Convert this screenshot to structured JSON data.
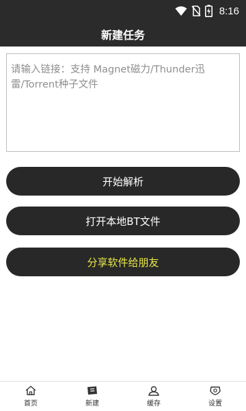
{
  "status_bar": {
    "time": "8:16",
    "icons": [
      "wifi-icon",
      "no-sim-icon",
      "battery-charging-icon"
    ]
  },
  "header": {
    "title": "新建任务"
  },
  "link_input": {
    "placeholder": "请输入链接：支持 Magnet磁力/Thunder迅雷/Torrent种子文件",
    "value": ""
  },
  "buttons": {
    "parse_label": "开始解析",
    "open_bt_label": "打开本地BT文件",
    "share_label": "分享软件给朋友"
  },
  "colors": {
    "bar_bg": "#2b2b2b",
    "button_bg": "#282828",
    "share_text": "#e9e84a"
  },
  "bottom_nav": {
    "items": [
      {
        "label": "首页",
        "icon": "home-icon"
      },
      {
        "label": "新建",
        "icon": "new-task-icon"
      },
      {
        "label": "缓存",
        "icon": "cache-icon"
      },
      {
        "label": "设置",
        "icon": "settings-icon"
      }
    ]
  }
}
